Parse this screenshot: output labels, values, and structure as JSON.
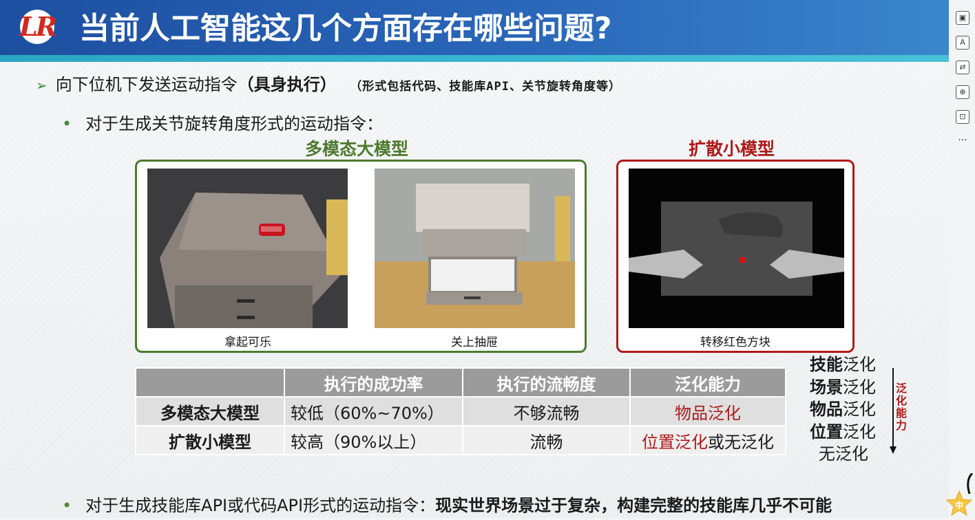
{
  "header": {
    "title": "当前人工智能这几个方面存在哪些问题?",
    "logo_text": "LR"
  },
  "bullet1": {
    "text": "向下位机下发送运动指令",
    "bold": "（具身执行）",
    "note": "（形式包括代码、技能库API、关节旋转角度等）"
  },
  "bullet2": {
    "text": "对于生成关节旋转角度形式的运动指令："
  },
  "panels": {
    "left_label": "多模态大模型",
    "right_label": "扩散小模型",
    "images": [
      {
        "caption": "拿起可乐"
      },
      {
        "caption": "关上抽屉"
      },
      {
        "caption": "转移红色方块"
      }
    ]
  },
  "table": {
    "headers": [
      "",
      "执行的成功率",
      "执行的流畅度",
      "泛化能力"
    ],
    "rows": [
      {
        "name": "多模态大模型",
        "rate": "较低（60%~70%）",
        "smooth": "不够流畅",
        "gen_red": "物品泛化",
        "gen_rest": ""
      },
      {
        "name": "扩散小模型",
        "rate": "较高（90%以上）",
        "smooth": "流畅",
        "gen_red": "位置泛化",
        "gen_rest": "或无泛化"
      }
    ]
  },
  "generalization": {
    "levels": [
      {
        "bold": "技能",
        "rest": "泛化"
      },
      {
        "bold": "场景",
        "rest": "泛化"
      },
      {
        "bold": "物品",
        "rest": "泛化"
      },
      {
        "bold": "位置",
        "rest": "泛化"
      },
      {
        "bold": "",
        "rest": "无泛化"
      }
    ],
    "axis_label": [
      "泛",
      "化",
      "能",
      "力"
    ]
  },
  "bullet3": {
    "text": "对于生成技能库API或代码API形式的运动指令：",
    "bold": "现实世界场景过于复杂，构建完整的技能库几乎不可能"
  },
  "toolbar": {
    "ime": "中",
    "more": "···"
  },
  "colors": {
    "title_bar": "#1d4fa0",
    "green": "#4c7a2e",
    "red": "#b01818"
  }
}
